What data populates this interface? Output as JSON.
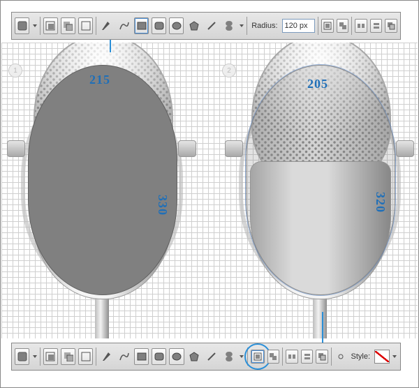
{
  "topbar": {
    "radius_label": "Radius:",
    "radius_value": "120 px"
  },
  "bottombar": {
    "style_label": "Style:"
  },
  "canvas": {
    "step1_badge": "1",
    "step2_badge": "2",
    "left": {
      "width": "215",
      "height": "330"
    },
    "right": {
      "width": "205",
      "height": "320"
    }
  },
  "icons": {
    "fill": "fill-swatch",
    "drop": "dd",
    "new": "new-shape",
    "union": "union",
    "subtract": "subtract",
    "pen": "pen",
    "freeform": "freeform-pen",
    "rect": "rectangle",
    "roundrect": "rounded-rectangle",
    "ellipse": "ellipse",
    "polygon": "polygon",
    "line": "line",
    "custom": "custom-shape",
    "align1": "align-edges",
    "align2": "align-center",
    "dist1": "distribute-h",
    "dist2": "distribute-v",
    "arrange": "arrange",
    "link": "link-paths",
    "noStyle": "no-style"
  }
}
